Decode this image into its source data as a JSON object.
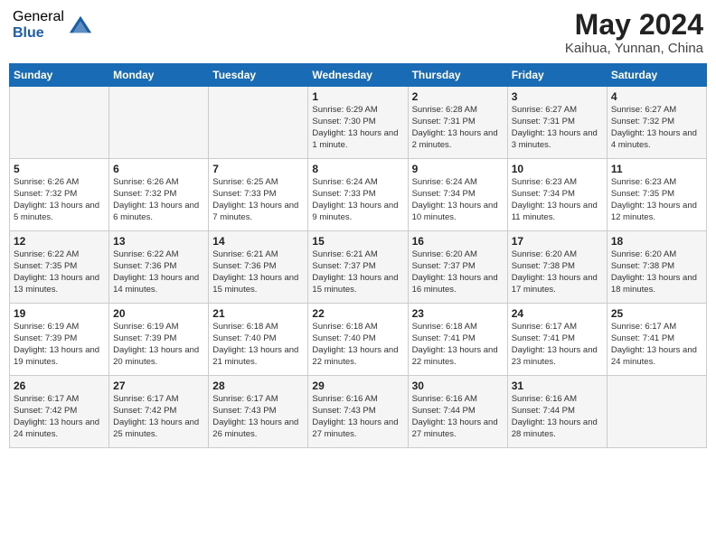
{
  "header": {
    "logo_general": "General",
    "logo_blue": "Blue",
    "month_title": "May 2024",
    "location": "Kaihua, Yunnan, China"
  },
  "days_of_week": [
    "Sunday",
    "Monday",
    "Tuesday",
    "Wednesday",
    "Thursday",
    "Friday",
    "Saturday"
  ],
  "weeks": [
    [
      {
        "day": "",
        "info": ""
      },
      {
        "day": "",
        "info": ""
      },
      {
        "day": "",
        "info": ""
      },
      {
        "day": "1",
        "info": "Sunrise: 6:29 AM\nSunset: 7:30 PM\nDaylight: 13 hours\nand 1 minute."
      },
      {
        "day": "2",
        "info": "Sunrise: 6:28 AM\nSunset: 7:31 PM\nDaylight: 13 hours\nand 2 minutes."
      },
      {
        "day": "3",
        "info": "Sunrise: 6:27 AM\nSunset: 7:31 PM\nDaylight: 13 hours\nand 3 minutes."
      },
      {
        "day": "4",
        "info": "Sunrise: 6:27 AM\nSunset: 7:32 PM\nDaylight: 13 hours\nand 4 minutes."
      }
    ],
    [
      {
        "day": "5",
        "info": "Sunrise: 6:26 AM\nSunset: 7:32 PM\nDaylight: 13 hours\nand 5 minutes."
      },
      {
        "day": "6",
        "info": "Sunrise: 6:26 AM\nSunset: 7:32 PM\nDaylight: 13 hours\nand 6 minutes."
      },
      {
        "day": "7",
        "info": "Sunrise: 6:25 AM\nSunset: 7:33 PM\nDaylight: 13 hours\nand 7 minutes."
      },
      {
        "day": "8",
        "info": "Sunrise: 6:24 AM\nSunset: 7:33 PM\nDaylight: 13 hours\nand 9 minutes."
      },
      {
        "day": "9",
        "info": "Sunrise: 6:24 AM\nSunset: 7:34 PM\nDaylight: 13 hours\nand 10 minutes."
      },
      {
        "day": "10",
        "info": "Sunrise: 6:23 AM\nSunset: 7:34 PM\nDaylight: 13 hours\nand 11 minutes."
      },
      {
        "day": "11",
        "info": "Sunrise: 6:23 AM\nSunset: 7:35 PM\nDaylight: 13 hours\nand 12 minutes."
      }
    ],
    [
      {
        "day": "12",
        "info": "Sunrise: 6:22 AM\nSunset: 7:35 PM\nDaylight: 13 hours\nand 13 minutes."
      },
      {
        "day": "13",
        "info": "Sunrise: 6:22 AM\nSunset: 7:36 PM\nDaylight: 13 hours\nand 14 minutes."
      },
      {
        "day": "14",
        "info": "Sunrise: 6:21 AM\nSunset: 7:36 PM\nDaylight: 13 hours\nand 15 minutes."
      },
      {
        "day": "15",
        "info": "Sunrise: 6:21 AM\nSunset: 7:37 PM\nDaylight: 13 hours\nand 15 minutes."
      },
      {
        "day": "16",
        "info": "Sunrise: 6:20 AM\nSunset: 7:37 PM\nDaylight: 13 hours\nand 16 minutes."
      },
      {
        "day": "17",
        "info": "Sunrise: 6:20 AM\nSunset: 7:38 PM\nDaylight: 13 hours\nand 17 minutes."
      },
      {
        "day": "18",
        "info": "Sunrise: 6:20 AM\nSunset: 7:38 PM\nDaylight: 13 hours\nand 18 minutes."
      }
    ],
    [
      {
        "day": "19",
        "info": "Sunrise: 6:19 AM\nSunset: 7:39 PM\nDaylight: 13 hours\nand 19 minutes."
      },
      {
        "day": "20",
        "info": "Sunrise: 6:19 AM\nSunset: 7:39 PM\nDaylight: 13 hours\nand 20 minutes."
      },
      {
        "day": "21",
        "info": "Sunrise: 6:18 AM\nSunset: 7:40 PM\nDaylight: 13 hours\nand 21 minutes."
      },
      {
        "day": "22",
        "info": "Sunrise: 6:18 AM\nSunset: 7:40 PM\nDaylight: 13 hours\nand 22 minutes."
      },
      {
        "day": "23",
        "info": "Sunrise: 6:18 AM\nSunset: 7:41 PM\nDaylight: 13 hours\nand 22 minutes."
      },
      {
        "day": "24",
        "info": "Sunrise: 6:17 AM\nSunset: 7:41 PM\nDaylight: 13 hours\nand 23 minutes."
      },
      {
        "day": "25",
        "info": "Sunrise: 6:17 AM\nSunset: 7:41 PM\nDaylight: 13 hours\nand 24 minutes."
      }
    ],
    [
      {
        "day": "26",
        "info": "Sunrise: 6:17 AM\nSunset: 7:42 PM\nDaylight: 13 hours\nand 24 minutes."
      },
      {
        "day": "27",
        "info": "Sunrise: 6:17 AM\nSunset: 7:42 PM\nDaylight: 13 hours\nand 25 minutes."
      },
      {
        "day": "28",
        "info": "Sunrise: 6:17 AM\nSunset: 7:43 PM\nDaylight: 13 hours\nand 26 minutes."
      },
      {
        "day": "29",
        "info": "Sunrise: 6:16 AM\nSunset: 7:43 PM\nDaylight: 13 hours\nand 27 minutes."
      },
      {
        "day": "30",
        "info": "Sunrise: 6:16 AM\nSunset: 7:44 PM\nDaylight: 13 hours\nand 27 minutes."
      },
      {
        "day": "31",
        "info": "Sunrise: 6:16 AM\nSunset: 7:44 PM\nDaylight: 13 hours\nand 28 minutes."
      },
      {
        "day": "",
        "info": ""
      }
    ]
  ]
}
